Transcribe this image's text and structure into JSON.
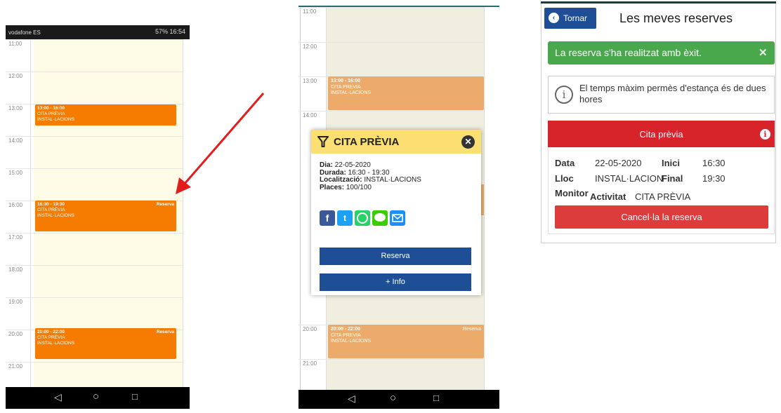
{
  "phone1": {
    "status_left": "vodafone ES",
    "status_right": "57% 16:54",
    "time_labels": [
      "11:00",
      "12:00",
      "13:00",
      "14:00",
      "15:00",
      "16:00",
      "17:00",
      "18:00",
      "19:00",
      "20:00",
      "21:00"
    ],
    "events": [
      {
        "time": "13:00 - 16:00",
        "title": "CITA PRÈVIA",
        "location": "INSTAL·LACIONS",
        "action": ""
      },
      {
        "time": "16:30 - 19:30",
        "title": "CITA PRÈVIA",
        "location": "INSTAL·LACIONS",
        "action": "Reserva"
      },
      {
        "time": "20:00 - 22:00",
        "title": "CITA PRÈVIA",
        "location": "INSTAL·LACIONS",
        "action": "Reserva"
      }
    ]
  },
  "phone2": {
    "time_labels": [
      "11:00",
      "12:00",
      "13:00",
      "14:00",
      "20:00",
      "21:00"
    ],
    "events": [
      {
        "time": "13:00 - 16:00",
        "title": "CITA PREVIA",
        "location": "INSTAL·LACIONS",
        "action": ""
      },
      {
        "time": "20:00 - 22:00",
        "title": "CITA PREVIA",
        "location": "INSTAL·LACIONS",
        "action": "Reserva"
      }
    ],
    "popup": {
      "title": "CITA PRÈVIA",
      "dia_label": "Dia:",
      "dia": "22-05-2020",
      "durada_label": "Durada:",
      "durada": "16:30 - 19:30",
      "loc_label": "Localització:",
      "loc": "INSTAL·LACIONS",
      "places_label": "Places:",
      "places": "100/100",
      "reserva_button": "Reserva",
      "info_button": "+ Info"
    }
  },
  "phone3": {
    "back_button": "Tornar",
    "page_title": "Les meves reserves",
    "alert": "La reserva s'ha realitzat amb èxit.",
    "info_text": "El temps màxim permès d'estança és de dues hores",
    "card_title": "Cita prèvia",
    "data_label": "Data",
    "data_value": "22-05-2020",
    "inici_label": "Inici",
    "inici_value": "16:30",
    "lloc_label": "Lloc",
    "lloc_value": "INSTAL·LACION",
    "final_label": "Final",
    "final_value": "19:30",
    "monitor_label": "Monitor",
    "activitat_label": "Activitat",
    "activitat_value": "CITA PRÈVIA",
    "cancel_button": "Cancel·la la reserva"
  },
  "colors": {
    "event_orange": "#f57c00",
    "event_muted": "#ecab6a",
    "calendar_bg": "#fefbe6",
    "popup_header": "#fbdf73",
    "button_blue": "#1e4e96",
    "success_green": "#49a84b",
    "card_red": "#d7242a",
    "cancel_red": "#dc3c3c",
    "arrow_red": "#e31c1c"
  }
}
